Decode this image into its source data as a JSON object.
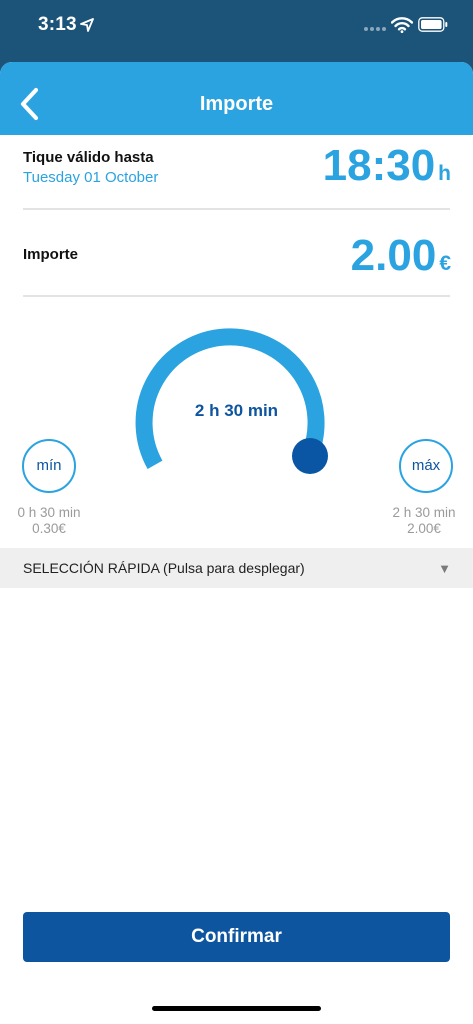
{
  "status_bar": {
    "time": "3:13"
  },
  "header": {
    "title": "Importe"
  },
  "ticket": {
    "label": "Tique válido hasta",
    "date": "Tuesday 01 October",
    "time_value": "18:30",
    "time_unit": "h"
  },
  "amount": {
    "label": "Importe",
    "value": "2.00",
    "unit": "€"
  },
  "duration_dial": {
    "label": "2 h 30 min",
    "fraction": 1.0
  },
  "min": {
    "button_label": "mín",
    "duration": "0 h 30 min",
    "price": "0.30€"
  },
  "max": {
    "button_label": "máx",
    "duration": "2 h 30 min",
    "price": "2.00€"
  },
  "quick_select": {
    "label": "SELECCIÓN RÁPIDA (Pulsa para desplegar)",
    "arrow": "▼"
  },
  "confirm": {
    "label": "Confirmar"
  },
  "colors": {
    "primary_blue": "#2aa3e0",
    "dark_blue": "#0e55a0",
    "status_bg": "#1b5478",
    "knob": "#0a56a4"
  },
  "icons": {
    "back": "chevron-left-icon",
    "location": "location-arrow-icon",
    "wifi": "wifi-icon",
    "battery": "battery-icon"
  }
}
